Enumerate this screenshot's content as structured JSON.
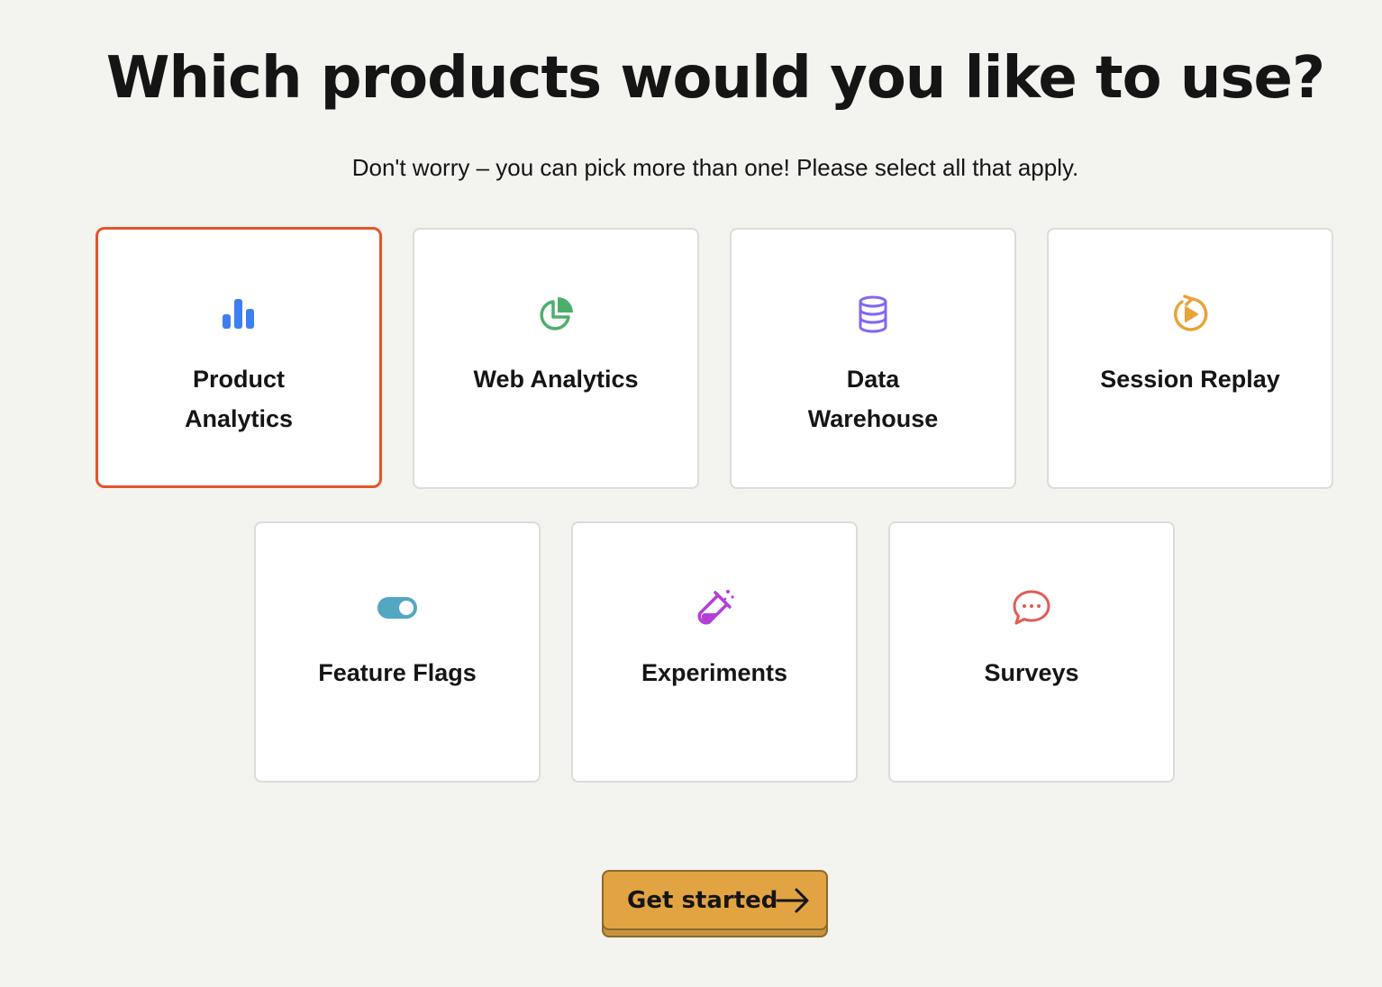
{
  "page": {
    "title": "Which products would you like to use?",
    "subtitle": "Don't worry – you can pick more than one! Please select all that apply."
  },
  "products": [
    {
      "label_lines": [
        "Product",
        "Analytics"
      ],
      "icon": "bar-chart-icon",
      "color": "#3e7ef0",
      "selected": true
    },
    {
      "label_lines": [
        "Web Analytics"
      ],
      "icon": "pie-chart-icon",
      "color": "#4cae6b",
      "selected": false
    },
    {
      "label_lines": [
        "Data",
        "Warehouse"
      ],
      "icon": "database-icon",
      "color": "#8566f0",
      "selected": false
    },
    {
      "label_lines": [
        "Session Replay"
      ],
      "icon": "replay-icon",
      "color": "#e8a33a",
      "selected": false
    },
    {
      "label_lines": [
        "Feature Flags"
      ],
      "icon": "toggle-icon",
      "color": "#53a7c3",
      "selected": false
    },
    {
      "label_lines": [
        "Experiments"
      ],
      "icon": "flask-icon",
      "color": "#b43fd6",
      "selected": false
    },
    {
      "label_lines": [
        "Surveys"
      ],
      "icon": "chat-bubble-icon",
      "color": "#e15c55",
      "selected": false
    }
  ],
  "cta": {
    "label": "Get started",
    "icon": "arrow-right-icon",
    "color": "#e2a343"
  },
  "colors": {
    "background": "#f3f3f0",
    "selected_border": "#e0562c"
  }
}
